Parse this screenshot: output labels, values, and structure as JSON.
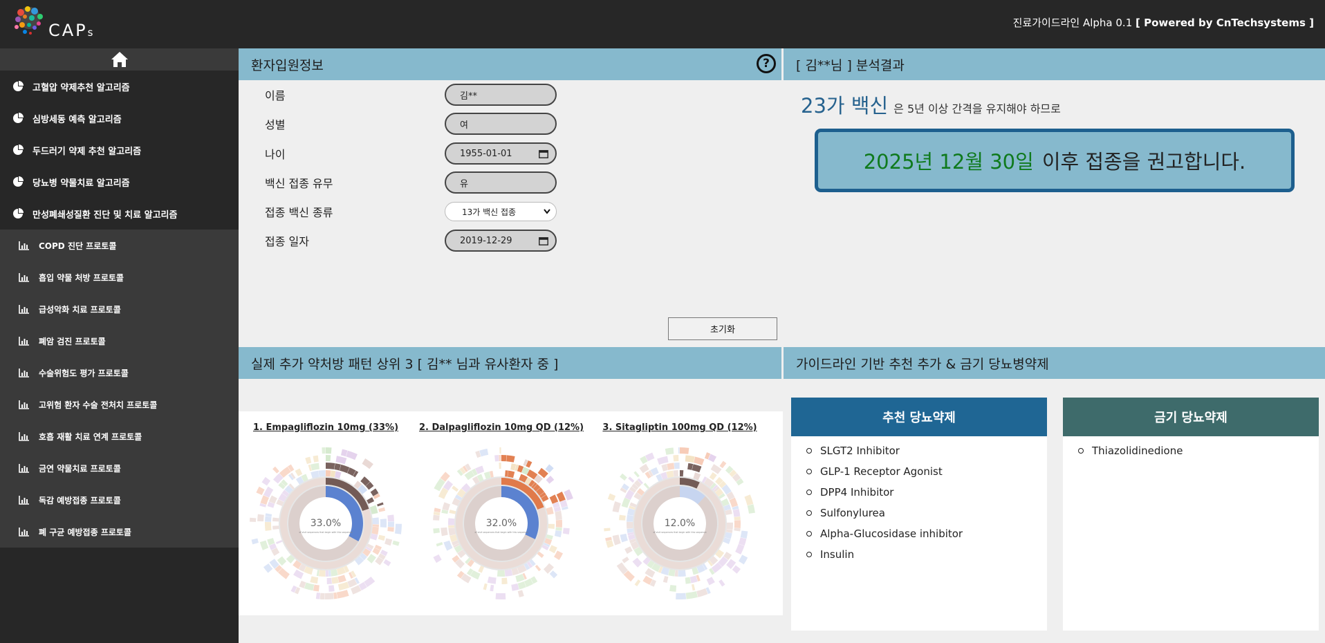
{
  "app": {
    "logo_text": "CAP",
    "logo_sub": "s",
    "title_prefix": "진료가이드라인 Alpha 0.1",
    "title_powered": "[ Powered by CnTechsystems ]"
  },
  "sidebar": {
    "main_items": [
      {
        "label": "고혈압 약제추천 알고리즘",
        "icon": "pie-chart-icon"
      },
      {
        "label": "심방세동 예측 알고리즘",
        "icon": "pie-chart-icon"
      },
      {
        "label": "두드러기 약제 추천 알고리즘",
        "icon": "pie-chart-icon"
      },
      {
        "label": "당뇨병 약물치료 알고리즘",
        "icon": "pie-chart-icon"
      },
      {
        "label": "만성폐쇄성질환 진단 및 치료 알고리즘",
        "icon": "pie-chart-icon"
      }
    ],
    "sub_items": [
      {
        "label": "COPD 진단 프로토콜",
        "icon": "bar-chart-icon"
      },
      {
        "label": "흡입 약물 처방 프로토콜",
        "icon": "bar-chart-icon"
      },
      {
        "label": "급성악화 치료 프로토콜",
        "icon": "bar-chart-icon"
      },
      {
        "label": "폐암 검진 프로토콜",
        "icon": "bar-chart-icon"
      },
      {
        "label": "수술위험도 평가 프로토콜",
        "icon": "bar-chart-icon"
      },
      {
        "label": "고위험 환자 수술 전처치 프로토콜",
        "icon": "bar-chart-icon"
      },
      {
        "label": "호흡 재활 치료 연계 프로토콜",
        "icon": "bar-chart-icon"
      },
      {
        "label": "금연 약물치료 프로토콜",
        "icon": "bar-chart-icon"
      },
      {
        "label": "독감 예방접종 프로토콜",
        "icon": "bar-chart-icon"
      },
      {
        "label": "폐 구균 예방접종 프로토콜",
        "icon": "bar-chart-icon"
      }
    ]
  },
  "patient_panel": {
    "title": "환자입원정보",
    "fields": {
      "name": {
        "label": "이름",
        "value": "김**"
      },
      "sex": {
        "label": "성별",
        "value": "여"
      },
      "age": {
        "label": "나이",
        "value": "1955-01-01"
      },
      "vaccinated": {
        "label": "백신 접종 유무",
        "value": "유"
      },
      "vaccine_type": {
        "label": "접종 백신 종류",
        "value": "13가 백신 접종"
      },
      "vaccine_date": {
        "label": "접종 일자",
        "value": "2019-12-29"
      }
    },
    "reset_label": "초기화"
  },
  "result_panel": {
    "title": "[ 김**님 ] 분석결과",
    "vaccine": "23가 백신",
    "interval_text": "은 5년 이상 간격을 유지해야 하므로",
    "recommend_date": "2025년 12월 30일",
    "recommend_text": "이후 접종을 권고합니다."
  },
  "patterns_panel": {
    "title": "실제 추가 약처방 패턴 상위 3 [ 김** 님과 유사환자 중 ]",
    "charts": [
      {
        "title": "1. Empagliflozin 10mg (33%)",
        "center": "33.0%",
        "caption": "of visit sequences that begin with this sequence"
      },
      {
        "title": "2. Dalpagliflozin 10mg QD (12%)",
        "center": "32.0%",
        "caption": "of visit sequences that begin with this sequence"
      },
      {
        "title": "3. Sitagliptin 100mg QD (12%)",
        "center": "12.0%",
        "caption": "of visit sequences that begin with this sequence"
      }
    ]
  },
  "chart_data": [
    {
      "type": "sunburst",
      "title": "1. Empagliflozin 10mg (33%)",
      "highlight_percent": 33.0
    },
    {
      "type": "sunburst",
      "title": "2. Dalpagliflozin 10mg QD (12%)",
      "highlight_percent": 32.0
    },
    {
      "type": "sunburst",
      "title": "3. Sitagliptin 100mg QD (12%)",
      "highlight_percent": 12.0
    }
  ],
  "guideline_panel": {
    "title": "가이드라인 기반 추천 추가 & 금기 당뇨병약제",
    "recommended": {
      "title": "추천 당뇨약제",
      "color": "#1f6694",
      "items": [
        "SLGT2 Inhibitor",
        "GLP-1 Receptor Agonist",
        "DPP4 Inhibitor",
        "Sulfonylurea",
        "Alpha-Glucosidase inhibitor",
        "Insulin"
      ]
    },
    "contraindicated": {
      "title": "금기 당뇨약제",
      "color": "#3e6b6b",
      "items": [
        "Thiazolidinedione"
      ]
    }
  },
  "colors": {
    "header_bar": "#86b9cd",
    "sidebar_bg": "#272727",
    "accent_blue": "#26628e",
    "accent_green": "#0f7a1d"
  }
}
